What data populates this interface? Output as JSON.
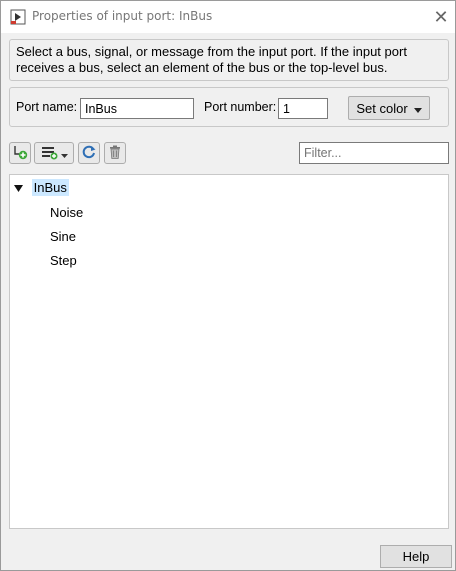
{
  "window": {
    "title": "Properties of input port: InBus",
    "close_label": "✕"
  },
  "description": "Select a bus, signal, or message from the input port. If the input port receives a bus, select an element of the bus or the top-level bus.",
  "port": {
    "name_label": "Port name:",
    "name_value": "InBus",
    "number_label": "Port number:",
    "number_value": "1",
    "set_color_label": "Set color"
  },
  "filter": {
    "placeholder": "Filter..."
  },
  "tree": {
    "root": "InBus",
    "children": [
      "Noise",
      "Sine",
      "Step"
    ]
  },
  "footer": {
    "help_label": "Help"
  }
}
